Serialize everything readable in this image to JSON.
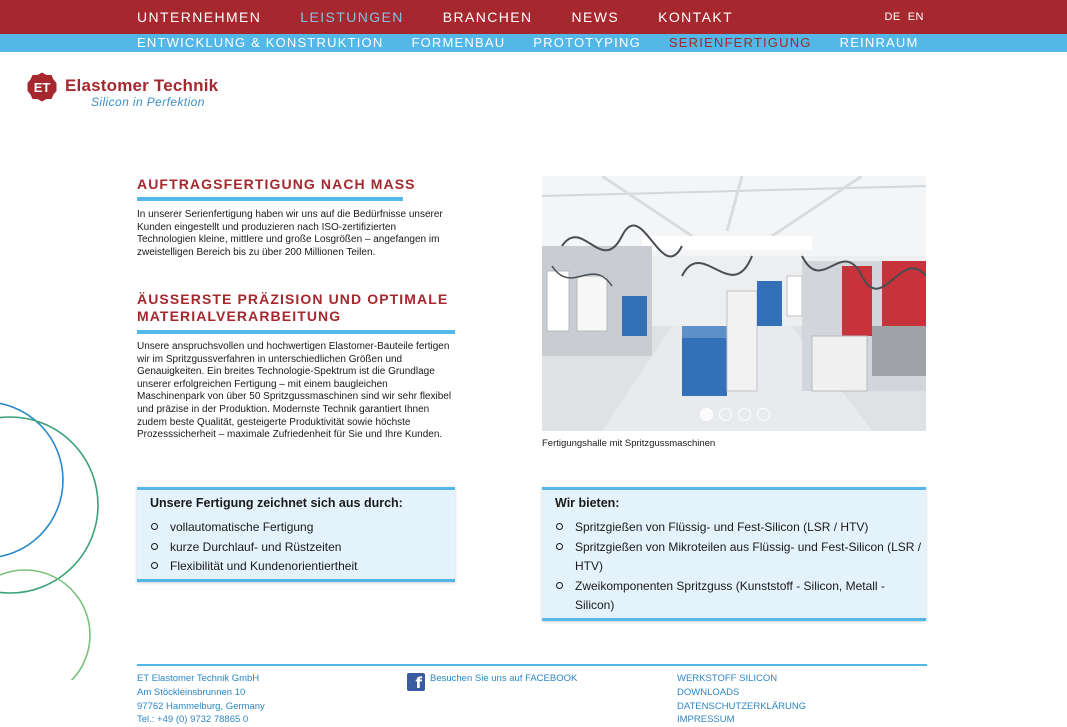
{
  "nav": {
    "items": [
      {
        "label": "UNTERNEHMEN"
      },
      {
        "label": "LEISTUNGEN"
      },
      {
        "label": "BRANCHEN"
      },
      {
        "label": "NEWS"
      },
      {
        "label": "KONTAKT"
      }
    ],
    "active": "LEISTUNGEN",
    "languages": [
      "DE",
      "EN"
    ]
  },
  "subnav": {
    "items": [
      {
        "label": "ENTWICKLUNG & KONSTRUKTION"
      },
      {
        "label": "FORMENBAU"
      },
      {
        "label": "PROTOTYPING"
      },
      {
        "label": "SERIENFERTIGUNG"
      },
      {
        "label": "REINRAUM"
      }
    ],
    "active": "SERIENFERTIGUNG"
  },
  "logo": {
    "mark": "ET",
    "name": "Elastomer Technik",
    "tagline": "Silicon in Perfektion"
  },
  "section1": {
    "heading": "AUFTRAGSFERTIGUNG NACH MASS",
    "text": "In unserer Serienfertigung haben wir uns auf die Bedürfnisse unserer Kunden eingestellt und produzieren nach ISO-zertifizierten Technologien kleine, mittlere und große Losgrößen – angefangen im zweistelligen Bereich bis zu über 200 Millionen Teilen."
  },
  "section2": {
    "heading_line1": "ÄUSSERSTE PRÄZISION UND OPTIMALE",
    "heading_line2": "MATERIALVERARBEITUNG",
    "text": "Unsere anspruchsvollen und hochwertigen Elastomer-Bauteile fertigen wir im Spritzgussverfahren in unterschiedlichen Größen und Genauigkeiten. Ein breites Technologie-Spektrum ist die Grundlage unserer erfolgreichen Fertigung – mit einem baugleichen Maschinenpark von über 50 Spritzgussmaschinen sind wir sehr flexibel und präzise in der Produktion. Modernste Technik garantiert Ihnen zudem beste Qualität, gesteigerte Produktivität sowie höchste Prozesssicherheit – maximale Zufriedenheit für Sie und Ihre Kunden."
  },
  "slider": {
    "caption": "Fertigungshalle mit Spritzgussmaschinen",
    "slide_count": 4,
    "active_slide": 1
  },
  "box_left": {
    "title": "Unsere Fertigung zeichnet sich aus durch:",
    "items": [
      "vollautomatische Fertigung",
      "kurze Durchlauf- und Rüstzeiten",
      "Flexibilität und Kundenorientiertheit"
    ]
  },
  "box_right": {
    "title": "Wir bieten:",
    "items": [
      "Spritzgießen von Flüssig- und Fest-Silicon (LSR / HTV)",
      "Spritzgießen von Mikroteilen aus Flüssig- und Fest-Silicon (LSR / HTV)",
      "Zweikomponenten Spritzguss (Kunststoff - Silicon, Metall - Silicon)"
    ]
  },
  "footer": {
    "address": [
      "ET Elastomer Technik GmbH",
      "Am Stöckleinsbrunnen 10",
      "97762 Hammelburg, Germany",
      "Tel.: +49 (0) 9732 78865 0"
    ],
    "facebook": "Besuchen Sie uns auf FACEBOOK",
    "links": [
      "WERKSTOFF SILICON",
      "DOWNLOADS",
      "DATENSCHUTZERKLÄRUNG",
      "IMPRESSUM"
    ]
  },
  "colors": {
    "brand_red": "#a6272d",
    "accent_blue": "#53b7e8",
    "box_bg": "#e4f3fb",
    "link_blue": "#2d86c6"
  }
}
